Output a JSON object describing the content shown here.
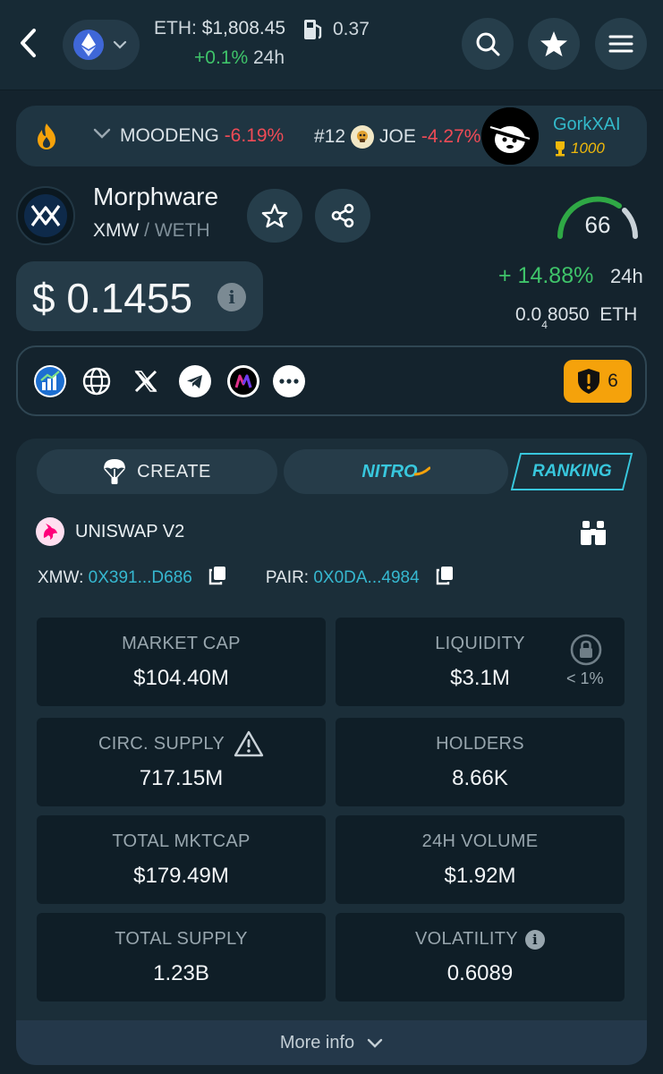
{
  "header": {
    "eth_label": "ETH:",
    "eth_price": "$1,808.45",
    "gas_value": "0.37",
    "eth_change": "+0.1%",
    "eth_change_period": "24h"
  },
  "ticker": {
    "item1_name": "MOODENG",
    "item1_change": "-6.19%",
    "item2_rank": "#12",
    "item2_name": "JOE",
    "item2_change": "-4.27%",
    "promo_name": "GorkXAI",
    "promo_score": "1000"
  },
  "token": {
    "name": "Morphware",
    "symbol": "XMW",
    "pair_separator": "/",
    "quote": "WETH",
    "score": "66",
    "price": "$ 0.1455",
    "change": "+ 14.88%",
    "change_period": "24h",
    "eth_price_prefix": "0.0",
    "eth_price_sub": "4",
    "eth_price_digits": "8050",
    "eth_price_unit": "ETH",
    "audit_count": "6"
  },
  "tabs": {
    "create": "CREATE",
    "nitro": "NITRO",
    "ranking": "RANKING"
  },
  "dex": {
    "name": "UNISWAP V2",
    "token_label": "XMW:",
    "token_address": "0X391...D686",
    "pair_label": "PAIR:",
    "pair_address": "0X0DA...4984"
  },
  "stats": {
    "market_cap_label": "MARKET CAP",
    "market_cap": "$104.40M",
    "liquidity_label": "LIQUIDITY",
    "liquidity": "$3.1M",
    "liquidity_locked": "< 1%",
    "circ_supply_label": "CIRC. SUPPLY",
    "circ_supply": "717.15M",
    "holders_label": "HOLDERS",
    "holders": "8.66K",
    "total_mktcap_label": "TOTAL MKTCAP",
    "total_mktcap": "$179.49M",
    "volume_label": "24H VOLUME",
    "volume": "$1.92M",
    "total_supply_label": "TOTAL SUPPLY",
    "total_supply": "1.23B",
    "volatility_label": "VOLATILITY",
    "volatility": "0.6089"
  },
  "footer": {
    "more_info": "More info"
  },
  "colors": {
    "background": "#14232d",
    "accent": "#38c7dd",
    "positive": "#3fc46a",
    "negative": "#ef4b56",
    "audit": "#f5a20b"
  },
  "icons": [
    "back-arrow-icon",
    "ethereum-icon",
    "chevron-down-icon",
    "gas-pump-icon",
    "search-icon",
    "star-icon",
    "menu-icon",
    "flame-icon",
    "share-icon",
    "info-icon",
    "chart-icon",
    "globe-icon",
    "x-icon",
    "telegram-icon",
    "m-icon",
    "more-icon",
    "shield-alert-icon",
    "parachute-icon",
    "uniswap-icon",
    "binoculars-icon",
    "copy-icon",
    "lock-icon",
    "warning-icon"
  ]
}
